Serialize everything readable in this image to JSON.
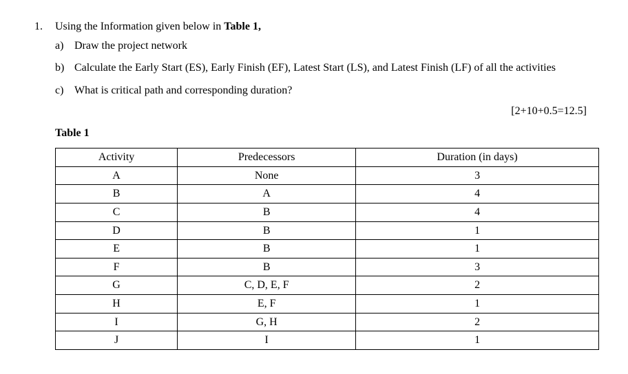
{
  "question": {
    "number": "1.",
    "intro_prefix": "Using the Information given below in ",
    "intro_bold": "Table 1,",
    "parts": [
      {
        "marker": "a)",
        "text": "Draw the project network"
      },
      {
        "marker": "b)",
        "text": "Calculate the Early Start (ES), Early Finish (EF), Latest Start (LS), and Latest Finish (LF) of all the activities"
      },
      {
        "marker": "c)",
        "text": "What is critical path and corresponding duration?"
      }
    ],
    "marks": "[2+10+0.5=12.5]"
  },
  "table": {
    "title": "Table 1",
    "headers": [
      "Activity",
      "Predecessors",
      "Duration (in days)"
    ],
    "rows": [
      {
        "activity": "A",
        "predecessors": "None",
        "duration": "3"
      },
      {
        "activity": "B",
        "predecessors": "A",
        "duration": "4"
      },
      {
        "activity": "C",
        "predecessors": "B",
        "duration": "4"
      },
      {
        "activity": "D",
        "predecessors": "B",
        "duration": "1"
      },
      {
        "activity": "E",
        "predecessors": "B",
        "duration": "1"
      },
      {
        "activity": "F",
        "predecessors": "B",
        "duration": "3"
      },
      {
        "activity": "G",
        "predecessors": "C, D, E, F",
        "duration": "2"
      },
      {
        "activity": "H",
        "predecessors": "E, F",
        "duration": "1"
      },
      {
        "activity": "I",
        "predecessors": "G, H",
        "duration": "2"
      },
      {
        "activity": "J",
        "predecessors": "I",
        "duration": "1"
      }
    ]
  },
  "chart_data": {
    "type": "table",
    "title": "Table 1",
    "columns": [
      "Activity",
      "Predecessors",
      "Duration (in days)"
    ],
    "data": [
      [
        "A",
        "None",
        3
      ],
      [
        "B",
        "A",
        4
      ],
      [
        "C",
        "B",
        4
      ],
      [
        "D",
        "B",
        1
      ],
      [
        "E",
        "B",
        1
      ],
      [
        "F",
        "B",
        3
      ],
      [
        "G",
        "C, D, E, F",
        2
      ],
      [
        "H",
        "E, F",
        1
      ],
      [
        "I",
        "G, H",
        2
      ],
      [
        "J",
        "I",
        1
      ]
    ]
  }
}
